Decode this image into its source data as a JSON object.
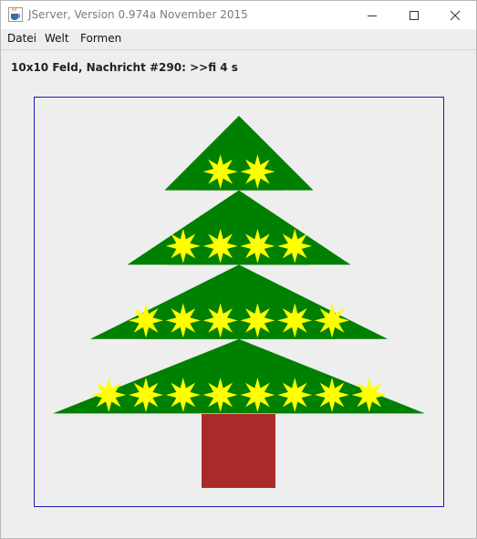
{
  "window": {
    "title": "JServer, Version 0.974a November 2015",
    "app_icon": "java-coffee-cup-icon",
    "controls": {
      "minimize_icon": "minimize-icon",
      "maximize_icon": "maximize-icon",
      "close_icon": "close-icon"
    }
  },
  "menubar": {
    "items": [
      {
        "label": "Datei"
      },
      {
        "label": "Welt"
      },
      {
        "label": "Formen"
      }
    ]
  },
  "status": {
    "text": "10x10 Feld, Nachricht #290: >>fi 4 s"
  },
  "canvas": {
    "grid": "10x10",
    "border_color": "#1b1bb0",
    "background_color": "#eeeeee",
    "tree": {
      "foliage_color": "#008000",
      "trunk_color": "#aa2a2a",
      "star_color": "#ffff00",
      "star_rows": [
        {
          "row": 1,
          "count": 2
        },
        {
          "row": 3,
          "count": 4
        },
        {
          "row": 5,
          "count": 6
        },
        {
          "row": 7,
          "count": 8
        }
      ]
    }
  }
}
